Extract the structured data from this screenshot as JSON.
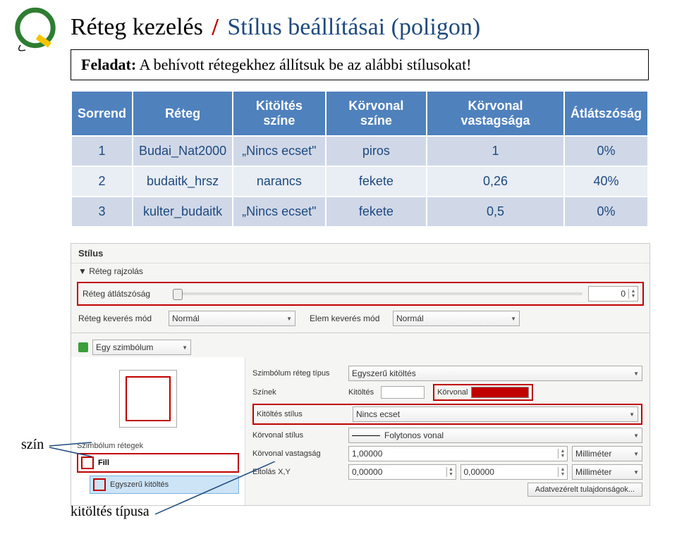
{
  "title": {
    "black": "Réteg kezelés",
    "slash": "/",
    "blue": "Stílus beállításai (poligon)"
  },
  "task": {
    "label": "Feladat:",
    "text": " A behívott rétegekhez állítsuk be az alábbi stílusokat!"
  },
  "table": {
    "headers": [
      "Sorrend",
      "Réteg",
      "Kitöltés színe",
      "Körvonal színe",
      "Körvonal vastagsága",
      "Átlátszóság"
    ],
    "rows": [
      [
        "1",
        "Budai_Nat2000",
        "„Nincs ecset\"",
        "piros",
        "1",
        "0%"
      ],
      [
        "2",
        "budaitk_hrsz",
        "narancs",
        "fekete",
        "0,26",
        "40%"
      ],
      [
        "3",
        "kulter_budaitk",
        "„Nincs ecset\"",
        "fekete",
        "0,5",
        "0%"
      ]
    ]
  },
  "panel": {
    "header": "Stílus",
    "sub": "▼ Réteg rajzolás",
    "opacity_label": "Réteg átlátszóság",
    "opacity_value": "0",
    "blend1_label": "Réteg keverés mód",
    "blend1_value": "Normál",
    "blend2_label": "Elem keverés mód",
    "blend2_value": "Normál",
    "symtype": "Egy szimbólum",
    "layers_title": "Szimbólum rétegek",
    "layer_fill": "Fill",
    "layer_simple": "Egyszerű kitöltés",
    "props": {
      "symlayer_label": "Szimbólum réteg típus",
      "symlayer_value": "Egyszerű kitöltés",
      "colors_label": "Színek",
      "fill_label": "Kitöltés",
      "outline_label": "Körvonal",
      "fillstyle_label": "Kitöltés stílus",
      "fillstyle_value": "Nincs ecset",
      "outlinestyle_label": "Körvonal stílus",
      "outlinestyle_value": "Folytonos vonal",
      "outlinewidth_label": "Körvonal vastagság",
      "outlinewidth_value": "1,00000",
      "unit1": "Milliméter",
      "offset_label": "Eltolás X,Y",
      "offset_x": "0,00000",
      "offset_y": "0,00000",
      "unit2": "Milliméter",
      "data_driven": "Adatvezérelt tulajdonságok..."
    }
  },
  "annotations": {
    "szin": "szín",
    "kitoltes": "kitöltés típusa"
  }
}
